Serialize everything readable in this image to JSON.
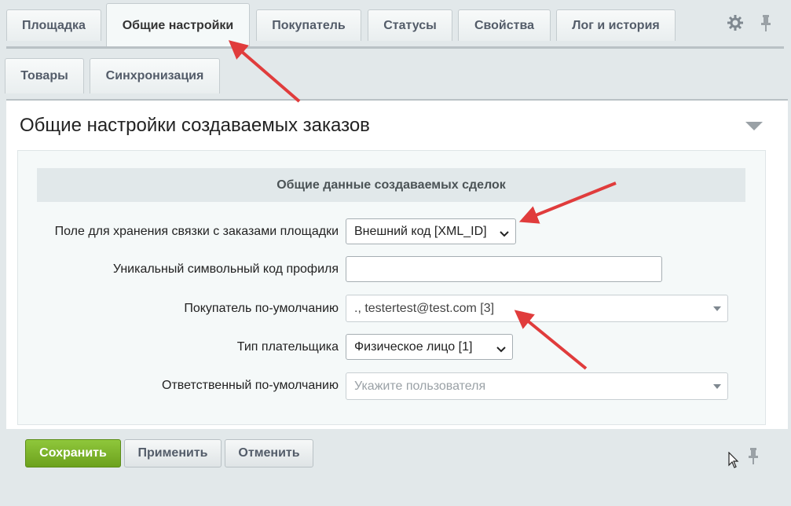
{
  "tabs_row1": [
    {
      "label": "Площадка",
      "active": false
    },
    {
      "label": "Общие настройки",
      "active": true
    },
    {
      "label": "Покупатель",
      "active": false
    },
    {
      "label": "Статусы",
      "active": false
    },
    {
      "label": "Свойства",
      "active": false
    },
    {
      "label": "Лог и история",
      "active": false
    }
  ],
  "tabs_row2": [
    {
      "label": "Товары",
      "active": false
    },
    {
      "label": "Синхронизация",
      "active": false
    }
  ],
  "header_icons": [
    "gear-icon",
    "pin-icon"
  ],
  "card": {
    "title": "Общие настройки создаваемых заказов",
    "section_title": "Общие данные создаваемых сделок"
  },
  "fields": {
    "link_field": {
      "label": "Поле для хранения связки с заказами площадки",
      "value": "Внешний код [XML_ID]"
    },
    "profile_code": {
      "label": "Уникальный символьный код профиля",
      "value": ""
    },
    "default_buyer": {
      "label": "Покупатель по-умолчанию",
      "value": "., testertest@test.com [3]"
    },
    "payer_type": {
      "label": "Тип плательщика",
      "value": "Физическое лицо [1]"
    },
    "responsible": {
      "label": "Ответственный по-умолчанию",
      "placeholder": "Укажите пользователя"
    }
  },
  "buttons": {
    "save": "Сохранить",
    "apply": "Применить",
    "cancel": "Отменить"
  },
  "colors": {
    "accent_green": "#7ab32e",
    "annotation_arrow": "#e03c3c"
  }
}
